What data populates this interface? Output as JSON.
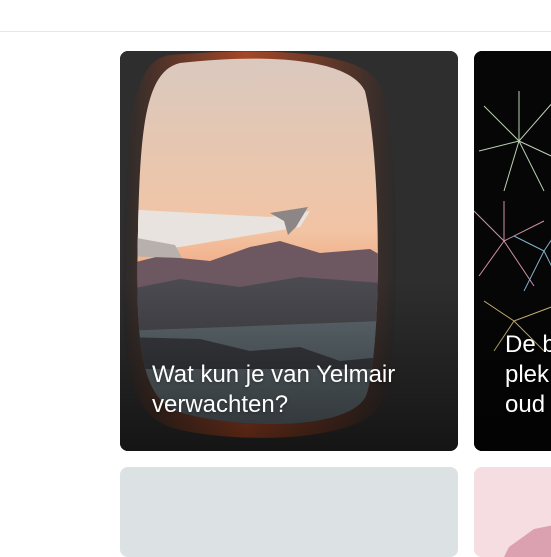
{
  "cards": [
    {
      "title": "Wat kun je van Yelmair verwachten?"
    },
    {
      "title": "De b\nplek\noud"
    }
  ],
  "colors": {
    "page_background": "#ffffff",
    "card_title_text": "#ffffff"
  }
}
